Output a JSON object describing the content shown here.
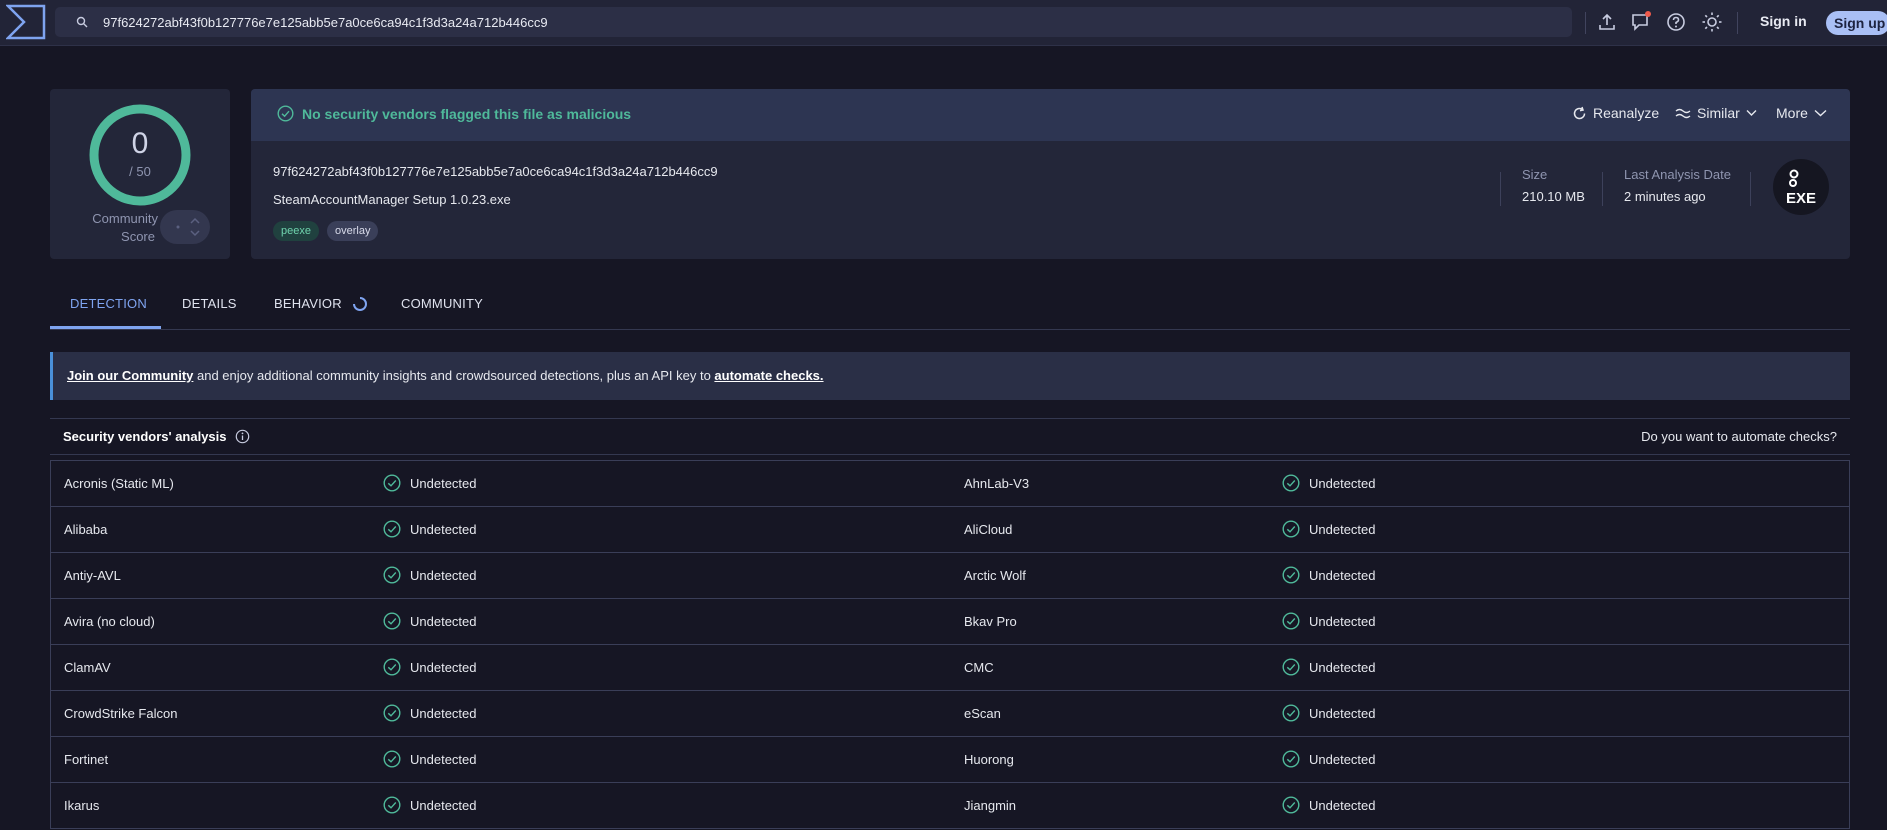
{
  "search": {
    "value": "97f624272abf43f0b127776e7e125abb5e7a0ce6ca94c1f3d3a24a712b446cc9"
  },
  "auth": {
    "signin": "Sign in",
    "signup": "Sign up"
  },
  "score": {
    "value": "0",
    "total": "/ 50",
    "label_line1": "Community",
    "label_line2": "Score",
    "ring_color": "#4fb99a"
  },
  "file": {
    "verdict": "No security vendors flagged this file as malicious",
    "hash": "97f624272abf43f0b127776e7e125abb5e7a0ce6ca94c1f3d3a24a712b446cc9",
    "name": "SteamAccountManager Setup 1.0.23.exe",
    "tags": [
      "peexe",
      "overlay"
    ],
    "size_label": "Size",
    "size": "210.10 MB",
    "date_label": "Last Analysis Date",
    "date": "2 minutes ago",
    "type_icon": "EXE"
  },
  "actions": {
    "reanalyze": "Reanalyze",
    "similar": "Similar",
    "more": "More"
  },
  "tabs": [
    "DETECTION",
    "DETAILS",
    "BEHAVIOR",
    "COMMUNITY"
  ],
  "banner": {
    "link1": "Join our Community",
    "middle": " and enjoy additional community insights and crowdsourced detections, plus an API key to ",
    "link2": "automate checks."
  },
  "vendors": {
    "title": "Security vendors' analysis",
    "automate": "Do you want to automate checks?",
    "rows": [
      [
        "Acronis (Static ML)",
        "Undetected",
        "AhnLab-V3",
        "Undetected"
      ],
      [
        "Alibaba",
        "Undetected",
        "AliCloud",
        "Undetected"
      ],
      [
        "Antiy-AVL",
        "Undetected",
        "Arctic Wolf",
        "Undetected"
      ],
      [
        "Avira (no cloud)",
        "Undetected",
        "Bkav Pro",
        "Undetected"
      ],
      [
        "ClamAV",
        "Undetected",
        "CMC",
        "Undetected"
      ],
      [
        "CrowdStrike Falcon",
        "Undetected",
        "eScan",
        "Undetected"
      ],
      [
        "Fortinet",
        "Undetected",
        "Huorong",
        "Undetected"
      ],
      [
        "Ikarus",
        "Undetected",
        "Jiangmin",
        "Undetected"
      ]
    ]
  },
  "colors": {
    "accent": "#7fa4f0",
    "success": "#4fb99a",
    "background": "#161624"
  }
}
